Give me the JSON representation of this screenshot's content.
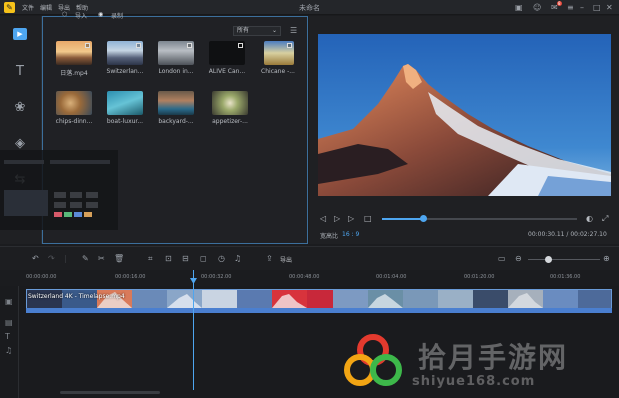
{
  "app": {
    "title": "未命名",
    "menu": [
      "文件",
      "编辑",
      "导出",
      "帮助"
    ],
    "logo_glyph": "✎",
    "notification_count": "8"
  },
  "media": {
    "import_label": "导入",
    "record_label": "录制",
    "filter_value": "所有",
    "items": [
      {
        "label": "日落.mp4"
      },
      {
        "label": "Switzerlan..."
      },
      {
        "label": "London in..."
      },
      {
        "label": "ALIVE  Can..."
      },
      {
        "label": "Chicane -..."
      },
      {
        "label": "chips-dinn..."
      },
      {
        "label": "boat-luxur..."
      },
      {
        "label": "backyard-..."
      },
      {
        "label": "appetizer-..."
      }
    ]
  },
  "preview": {
    "ratio_label": "宽高比",
    "ratio_value": "16 : 9",
    "timecode": "00:00:30.11 / 00:02:27.10",
    "progress": 0.2
  },
  "timeline": {
    "export_label": "导出",
    "ruler": [
      "00:00:00.00",
      "00:00:16.00",
      "00:00:32.00",
      "00:00:48.00",
      "00:01:04.00",
      "00:01:20.00",
      "00:01:36.00"
    ],
    "clip_title": "Switzerland 4K - Timelapse.mp4"
  },
  "watermark": {
    "text": "拾月手游网",
    "url": "shiyue168.com"
  },
  "colors": {
    "accent": "#4ea6f0",
    "clip": "#3b6fb4",
    "logo": "#f6c21a"
  }
}
